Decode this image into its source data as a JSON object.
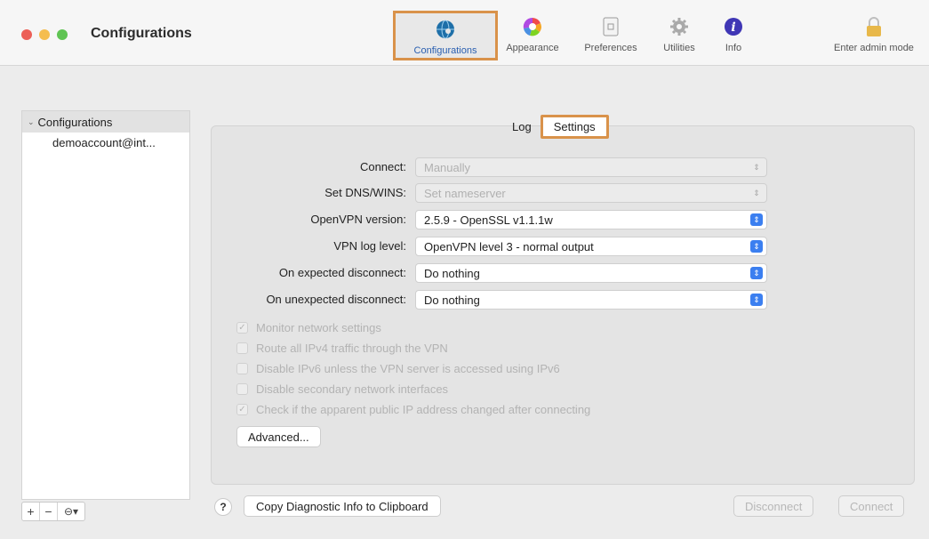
{
  "window": {
    "title": "Configurations"
  },
  "toolbar": {
    "items": [
      {
        "label": "Configurations",
        "icon": "globe-icon"
      },
      {
        "label": "Appearance",
        "icon": "color-wheel-icon"
      },
      {
        "label": "Preferences",
        "icon": "preferences-icon"
      },
      {
        "label": "Utilities",
        "icon": "gear-icon"
      },
      {
        "label": "Info",
        "icon": "info-icon"
      },
      {
        "label": "Enter admin mode",
        "icon": "lock-icon"
      }
    ]
  },
  "sidebar": {
    "header": "Configurations",
    "items": [
      {
        "label": "demoaccount@int..."
      }
    ],
    "buttons": {
      "add": "+",
      "remove": "−",
      "actions": "⊖▾"
    }
  },
  "tabs": {
    "log": "Log",
    "settings": "Settings"
  },
  "settings": {
    "rows": [
      {
        "label": "Connect:",
        "value": "Manually"
      },
      {
        "label": "Set DNS/WINS:",
        "value": "Set nameserver"
      },
      {
        "label": "OpenVPN version:",
        "value": "2.5.9 - OpenSSL v1.1.1w"
      },
      {
        "label": "VPN log level:",
        "value": "OpenVPN level 3 - normal output"
      },
      {
        "label": "On expected disconnect:",
        "value": "Do nothing"
      },
      {
        "label": "On unexpected disconnect:",
        "value": "Do nothing"
      }
    ],
    "checkboxes": [
      {
        "label": "Monitor network settings",
        "checked": true
      },
      {
        "label": "Route all IPv4 traffic through the VPN",
        "checked": false
      },
      {
        "label": "Disable IPv6 unless the VPN server is accessed using IPv6",
        "checked": false
      },
      {
        "label": "Disable secondary network interfaces",
        "checked": false
      },
      {
        "label": "Check if the apparent public IP address changed after connecting",
        "checked": true
      }
    ],
    "advanced_label": "Advanced..."
  },
  "footer": {
    "help": "?",
    "copy_label": "Copy Diagnostic Info to Clipboard",
    "disconnect_label": "Disconnect",
    "connect_label": "Connect"
  }
}
